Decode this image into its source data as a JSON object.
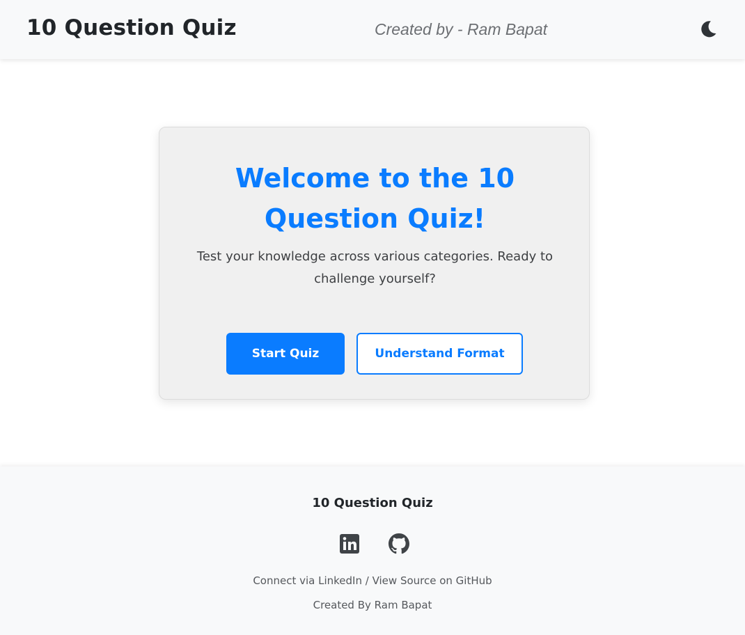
{
  "header": {
    "brand": "10 Question Quiz",
    "creator": "Created by - Ram Bapat",
    "theme_toggle_icon": "moon-icon"
  },
  "welcome_card": {
    "title": "Welcome to the 10 Question Quiz!",
    "description": "Test your knowledge across various categories. Ready to challenge yourself?",
    "start_button": "Start Quiz",
    "format_button": "Understand Format"
  },
  "footer": {
    "title": "10 Question Quiz",
    "icons": [
      "linkedin-icon",
      "github-icon"
    ],
    "linkedin_link": "Connect via LinkedIn",
    "separator": " / ",
    "github_link": "View Source on GitHub",
    "credit": "Created By Ram Bapat"
  },
  "colors": {
    "accent": "#0a7cff",
    "navbar_bg": "#f8f9fa",
    "card_bg": "#f0f0f0"
  }
}
